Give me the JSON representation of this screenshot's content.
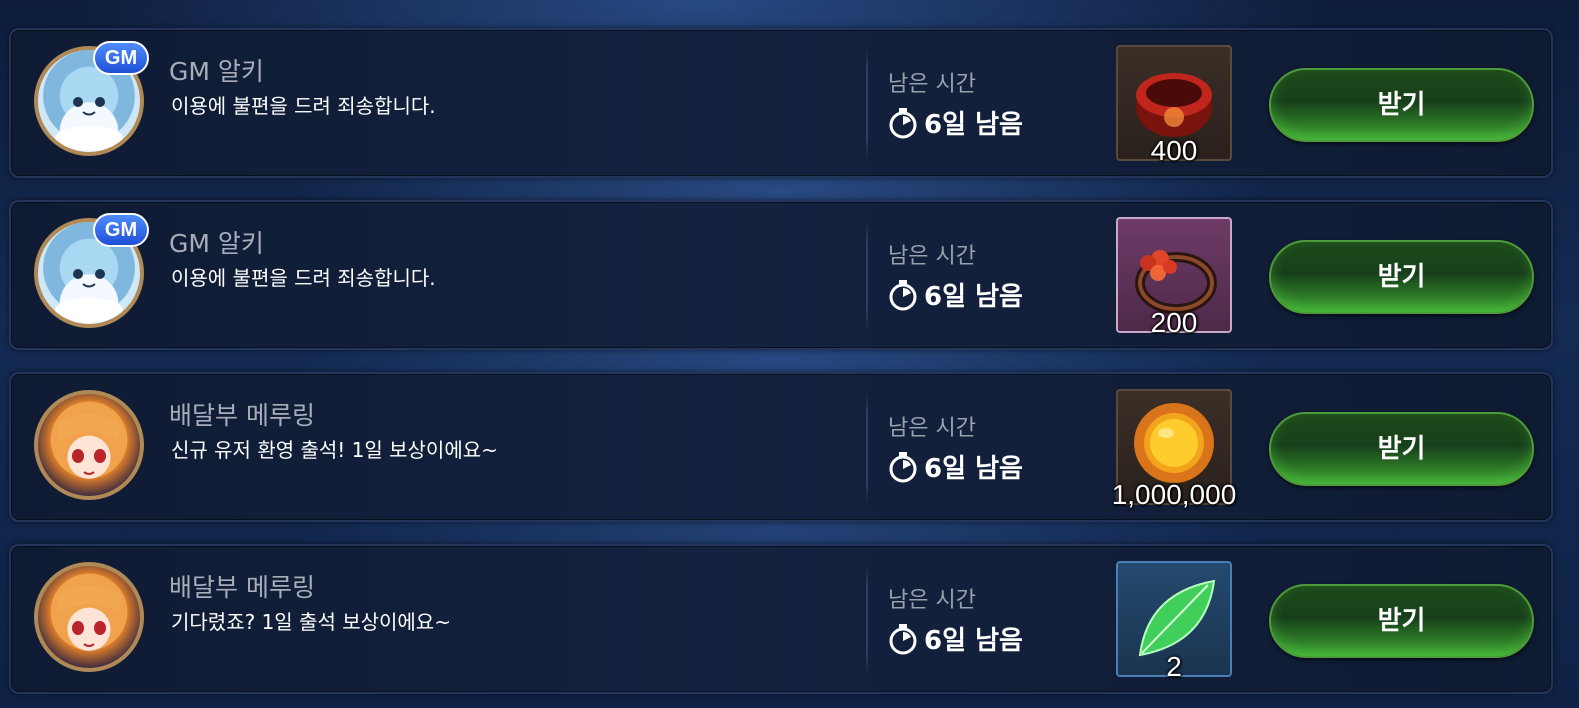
{
  "mails": [
    {
      "sender": "GM 알키",
      "gm_badge": "GM",
      "avatar": "gm-alki",
      "message": "이용에 불편을 드려 죄송합니다.",
      "time_label": "남은 시간",
      "time_remaining": "6일 남음",
      "item": "red-ring-icon",
      "quantity": "400",
      "claim_label": "받기"
    },
    {
      "sender": "GM 알키",
      "gm_badge": "GM",
      "avatar": "gm-alki",
      "message": "이용에 불편을 드려 죄송합니다.",
      "time_label": "남은 시간",
      "time_remaining": "6일 남음",
      "item": "flower-ring-icon",
      "quantity": "200",
      "claim_label": "받기"
    },
    {
      "sender": "배달부 메루링",
      "avatar": "courier-meruring",
      "message": "신규 유저 환영 출석! 1일 보상이에요~",
      "time_label": "남은 시간",
      "time_remaining": "6일 남음",
      "item": "gold-coin-icon",
      "quantity": "1,000,000",
      "claim_label": "받기"
    },
    {
      "sender": "배달부 메루링",
      "avatar": "courier-meruring",
      "message": "기다렸죠? 1일 출석 보상이에요~",
      "time_label": "남은 시간",
      "time_remaining": "6일 남음",
      "item": "green-leaf-icon",
      "quantity": "2",
      "claim_label": "받기"
    }
  ],
  "colors": {
    "button_green": "#2f7d28",
    "gm_badge_blue": "#1f4fd6",
    "panel_bg": "#14223f"
  }
}
